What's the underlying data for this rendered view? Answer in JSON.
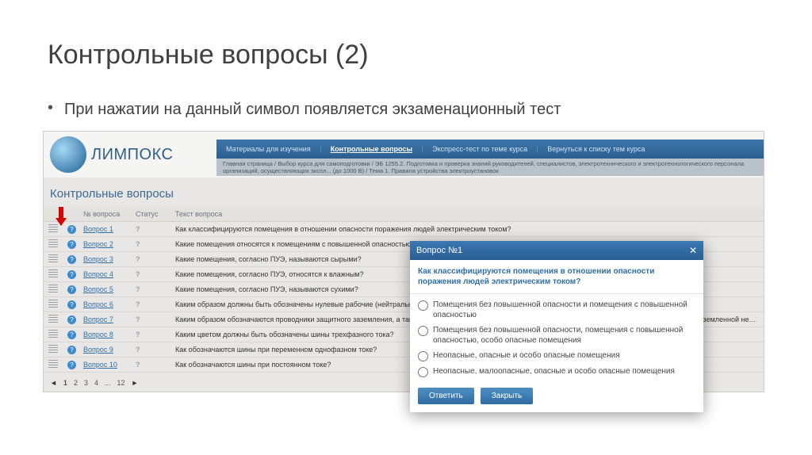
{
  "slide": {
    "title": "Контрольные вопросы (2)",
    "bullet": "При нажатии на данный символ появляется экзаменационный тест"
  },
  "app": {
    "brand": "ЛИМПОКС",
    "nav": {
      "materials": "Материалы для изучения",
      "questions": "Контрольные вопросы",
      "express": "Экспресс-тест по теме курса",
      "back": "Вернуться к списку тем курса"
    },
    "breadcrumb": "Главная страница / Выбор курса для самоподготовки / ЭБ 1255.2. Подготовка и проверка знаний руководителей, специалистов, электротехнического и электротехнологического персонала организаций, осуществляющих экспл... (до 1000 В) / Тема 1. Правила устройства электроустановок",
    "page_title": "Контрольные вопросы"
  },
  "table": {
    "headers": {
      "num": "№ вопроса",
      "status": "Статус",
      "text": "Текст вопроса"
    },
    "rows": [
      {
        "num": "Вопрос 1",
        "text": "Как классифицируются помещения в отношении опасности поражения людей электрическим током?"
      },
      {
        "num": "Вопрос 2",
        "text": "Какие помещения относятся к помещениям с повышенной опасностью поражения людей электрическим током?"
      },
      {
        "num": "Вопрос 3",
        "text": "Какие помещения, согласно ПУЭ, называются сырыми?"
      },
      {
        "num": "Вопрос 4",
        "text": "Какие помещения, согласно ПУЭ, относятся к влажным?"
      },
      {
        "num": "Вопрос 5",
        "text": "Какие помещения, согласно ПУЭ, называются сухими?"
      },
      {
        "num": "Вопрос 6",
        "text": "Каким образом должны быть обозначены нулевые рабочие (нейтральные) проводники в электроустановках?"
      },
      {
        "num": "Вопрос 7",
        "text": "Каким образом обозначаются проводники защитного заземления, а также нулевые защитные проводники в электроустановках напряжением до 1 кВ с глухозаземленной нейтралью?"
      },
      {
        "num": "Вопрос 8",
        "text": "Каким цветом должны быть обозначены шины трехфазного тока?"
      },
      {
        "num": "Вопрос 9",
        "text": "Как обозначаются шины при переменном однофазном токе?"
      },
      {
        "num": "Вопрос 10",
        "text": "Как обозначаются шины при постоянном токе?"
      }
    ]
  },
  "pager": {
    "p1": "1",
    "p2": "2",
    "p3": "3",
    "p4": "4",
    "dots": "...",
    "last": "12"
  },
  "modal": {
    "title": "Вопрос №1",
    "question": "Как классифицируются помещения в отношении опасности поражения людей электрическим током?",
    "o1": "Помещения без повышенной опасности и помещения с повышенной опасностью",
    "o2": "Помещения без повышенной опасности, помещения с повышенной опасностью, особо опасные помещения",
    "o3": "Неопасные, опасные и особо опасные помещения",
    "o4": "Неопасные, малоопасные, опасные и особо опасные помещения",
    "btn_answer": "Ответить",
    "btn_close": "Закрыть"
  }
}
